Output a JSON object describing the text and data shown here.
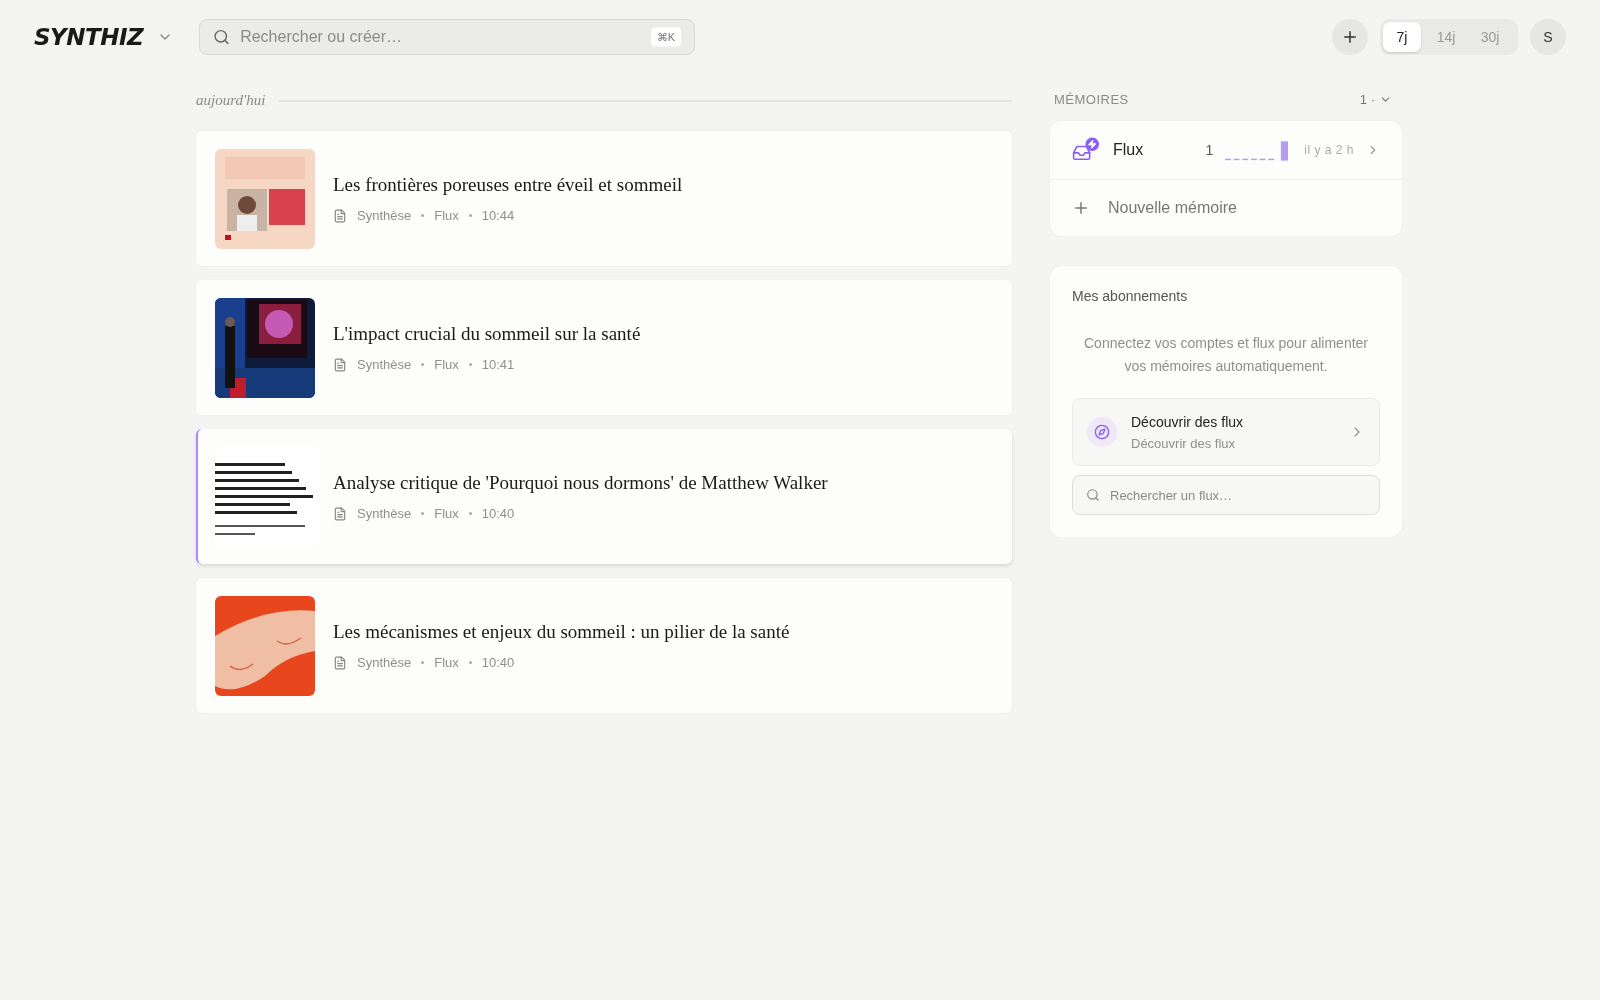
{
  "header": {
    "logo": "SYNTHIZ",
    "search": {
      "placeholder": "Rechercher ou créer…",
      "shortcut": "⌘K"
    },
    "ranges": [
      {
        "label": "7j",
        "selected": true
      },
      {
        "label": "14j",
        "selected": false
      },
      {
        "label": "30j",
        "selected": false
      }
    ],
    "avatar": "S"
  },
  "feed": {
    "group_label": "aujourd'hui",
    "items": [
      {
        "title": "Les frontières poreuses entre éveil et sommeil",
        "type": "Synthèse",
        "source": "Flux",
        "time": "10:44",
        "selected": false
      },
      {
        "title": "L'impact crucial du sommeil sur la santé",
        "type": "Synthèse",
        "source": "Flux",
        "time": "10:41",
        "selected": false
      },
      {
        "title": "Analyse critique de 'Pourquoi nous dormons' de Matthew Walker",
        "type": "Synthèse",
        "source": "Flux",
        "time": "10:40",
        "selected": true
      },
      {
        "title": "Les mécanismes et enjeux du sommeil : un pilier de la santé",
        "type": "Synthèse",
        "source": "Flux",
        "time": "10:40",
        "selected": false
      }
    ]
  },
  "memories": {
    "title": "MÉMOIRES",
    "count": "1 ·",
    "items": [
      {
        "name": "Flux",
        "count": "1",
        "time": "il y a 2 h"
      }
    ],
    "new_label": "Nouvelle mémoire"
  },
  "subscriptions": {
    "title": "Mes abonnements",
    "description": "Connectez vos comptes et flux pour alimenter vos mémoires automatiquement.",
    "discover": {
      "title": "Découvrir des flux",
      "subtitle": "Découvrir des flux"
    },
    "search": {
      "placeholder": "Rechercher un flux…"
    }
  }
}
